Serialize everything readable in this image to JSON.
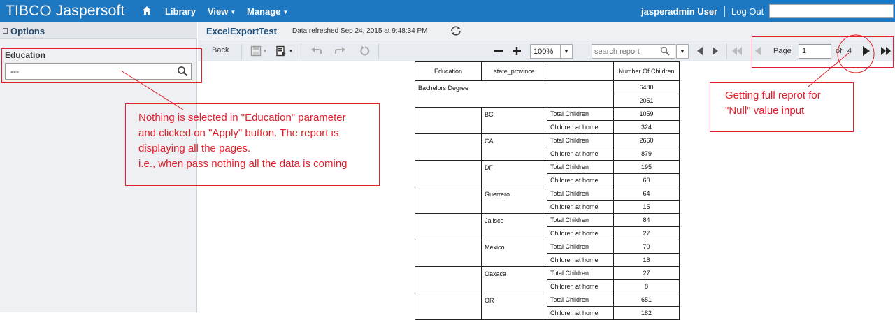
{
  "app": {
    "logo": "TIBC⭘ Jaspersoft"
  },
  "nav": {
    "library": "Library",
    "view": "View",
    "manage": "Manage",
    "user": "jasperadmin User",
    "logout": "Log Out"
  },
  "sidebar": {
    "title": "Options",
    "param_label": "Education",
    "param_value": "---"
  },
  "report": {
    "title": "ExcelExportTest",
    "refreshed": "Data refreshed Sep 24, 2015 at 9:48:34 PM"
  },
  "toolbar": {
    "back": "Back",
    "zoom": "100%",
    "search_placeholder": "search report",
    "page_label": "Page",
    "page_value": "1",
    "page_of": "of",
    "page_total": "4"
  },
  "table": {
    "headers": [
      "Education",
      "state_province",
      "",
      "Number Of Children"
    ],
    "group": "Bachelors Degree",
    "group_totals": [
      "6480",
      "2051"
    ],
    "rows": [
      {
        "state": "BC",
        "total": "1059",
        "home": "324"
      },
      {
        "state": "CA",
        "total": "2660",
        "home": "879"
      },
      {
        "state": "DF",
        "total": "195",
        "home": "60"
      },
      {
        "state": "Guerrero",
        "total": "64",
        "home": "15"
      },
      {
        "state": "Jalisco",
        "total": "84",
        "home": "27"
      },
      {
        "state": "Mexico",
        "total": "70",
        "home": "18"
      },
      {
        "state": "Oaxaca",
        "total": "27",
        "home": "8"
      },
      {
        "state": "OR",
        "total": "651",
        "home": "182"
      }
    ],
    "total_label": "Total Children",
    "home_label": "Children at home"
  },
  "annotations": {
    "left_lines": [
      "Nothing is selected in \"Education\" parameter",
      "and clicked on \"Apply\" button. The report is",
      "displaying all the pages.",
      "i.e., when pass nothing all the data is coming"
    ],
    "right_lines": [
      "Getting full reprot for",
      "\"Null\" value input"
    ]
  },
  "colors": {
    "topbar": "#1d78c1",
    "annotation": "#e0202a"
  }
}
